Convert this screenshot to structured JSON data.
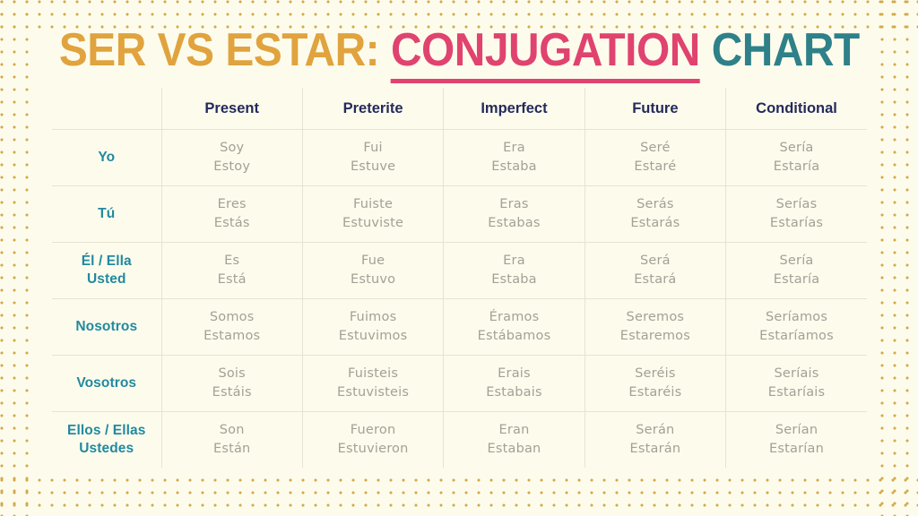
{
  "title": {
    "part1": "SER VS ESTAR:",
    "part2": "CONJUGATION",
    "part3": "CHART"
  },
  "colors": {
    "background": "#fdfcec",
    "title_amber": "#e0a33e",
    "title_pink": "#e0436f",
    "title_teal": "#2e8089",
    "header_navy": "#242a5c",
    "pronoun_teal": "#2289a0",
    "form_gray": "#a3a097",
    "grid_line": "#e6e3d2",
    "dot_gold": "#d2aa4e"
  },
  "table": {
    "corner_label": "",
    "columns": [
      "Present",
      "Preterite",
      "Imperfect",
      "Future",
      "Conditional"
    ],
    "rows": [
      {
        "pronoun": [
          "Yo"
        ],
        "cells": [
          [
            "Soy",
            "Estoy"
          ],
          [
            "Fui",
            "Estuve"
          ],
          [
            "Era",
            "Estaba"
          ],
          [
            "Seré",
            "Estaré"
          ],
          [
            "Sería",
            "Estaría"
          ]
        ]
      },
      {
        "pronoun": [
          "Tú"
        ],
        "cells": [
          [
            "Eres",
            "Estás"
          ],
          [
            "Fuiste",
            "Estuviste"
          ],
          [
            "Eras",
            "Estabas"
          ],
          [
            "Serás",
            "Estarás"
          ],
          [
            "Serías",
            "Estarías"
          ]
        ]
      },
      {
        "pronoun": [
          "Él / Ella",
          "Usted"
        ],
        "cells": [
          [
            "Es",
            "Está"
          ],
          [
            "Fue",
            "Estuvo"
          ],
          [
            "Era",
            "Estaba"
          ],
          [
            "Será",
            "Estará"
          ],
          [
            "Sería",
            "Estaría"
          ]
        ]
      },
      {
        "pronoun": [
          "Nosotros"
        ],
        "cells": [
          [
            "Somos",
            "Estamos"
          ],
          [
            "Fuimos",
            "Estuvimos"
          ],
          [
            "Éramos",
            "Estábamos"
          ],
          [
            "Seremos",
            "Estaremos"
          ],
          [
            "Seríamos",
            "Estaríamos"
          ]
        ]
      },
      {
        "pronoun": [
          "Vosotros"
        ],
        "cells": [
          [
            "Sois",
            "Estáis"
          ],
          [
            "Fuisteis",
            "Estuvisteis"
          ],
          [
            "Erais",
            "Estabais"
          ],
          [
            "Seréis",
            "Estaréis"
          ],
          [
            "Seríais",
            "Estaríais"
          ]
        ]
      },
      {
        "pronoun": [
          "Ellos / Ellas",
          "Ustedes"
        ],
        "cells": [
          [
            "Son",
            "Están"
          ],
          [
            "Fueron",
            "Estuvieron"
          ],
          [
            "Eran",
            "Estaban"
          ],
          [
            "Serán",
            "Estarán"
          ],
          [
            "Serían",
            "Estarían"
          ]
        ]
      }
    ]
  }
}
